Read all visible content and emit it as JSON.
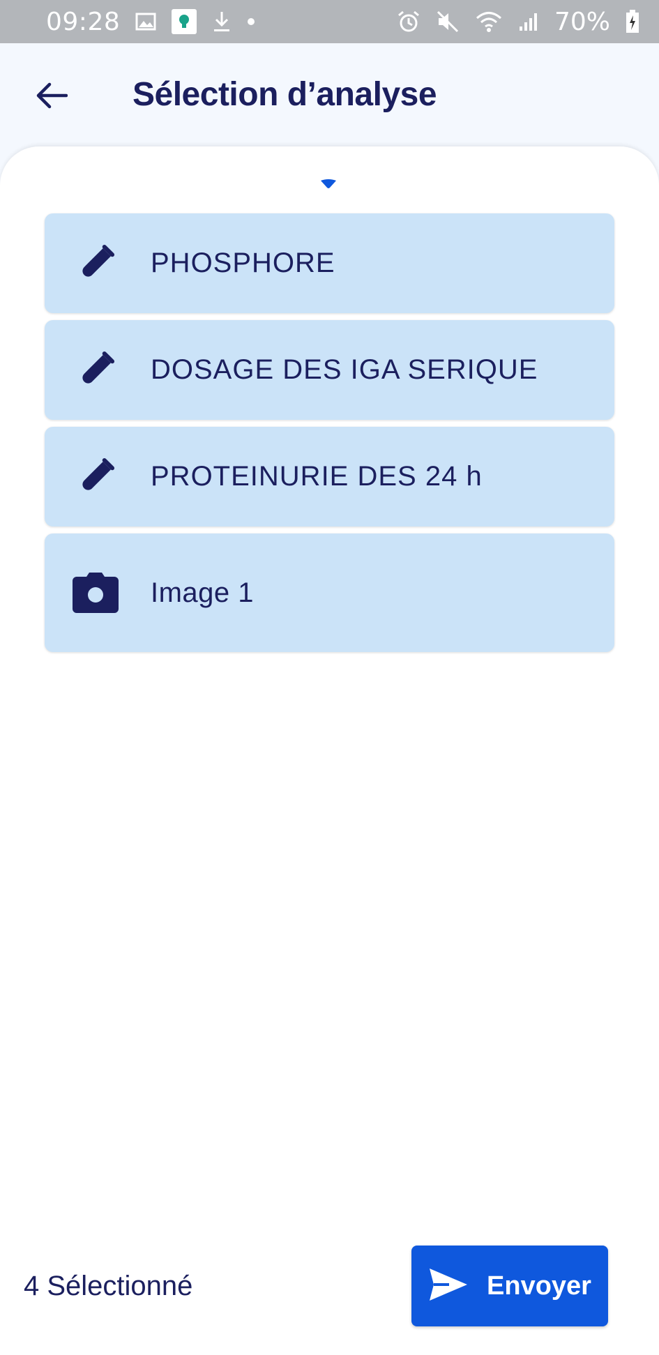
{
  "status_bar": {
    "time": "09:28",
    "battery": "70%",
    "icons": [
      "gallery-icon",
      "app-notification-icon",
      "download-icon",
      "dot-icon",
      "alarm-icon",
      "mute-icon",
      "wifi-icon",
      "signal-icon",
      "battery-charging-icon"
    ]
  },
  "header": {
    "title": "Sélection d’analyse",
    "back_icon": "arrow-left-icon"
  },
  "items": [
    {
      "label": "PHOSPHORE",
      "icon": "test-tube-icon"
    },
    {
      "label": "DOSAGE DES IGA SERIQUE",
      "icon": "test-tube-icon"
    },
    {
      "label": "PROTEINURIE DES 24 h",
      "icon": "test-tube-icon"
    },
    {
      "label": "Image 1",
      "icon": "camera-icon"
    }
  ],
  "footer": {
    "selected_count": "4 Sélectionné",
    "send_label": "Envoyer",
    "send_icon": "send-icon"
  },
  "colors": {
    "primary": "#0f58dd",
    "text": "#1b1f5e",
    "item_bg": "#cbe3f8",
    "status_bar": "#b3b6ba"
  }
}
